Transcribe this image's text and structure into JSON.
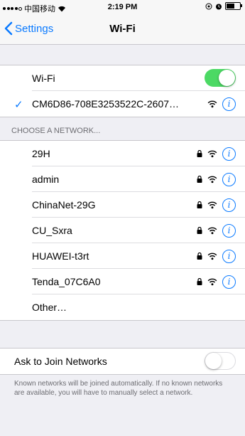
{
  "status_bar": {
    "carrier": "中国移动",
    "time": "2:19 PM"
  },
  "nav": {
    "back_label": "Settings",
    "title": "Wi-Fi"
  },
  "wifi_toggle": {
    "label": "Wi-Fi",
    "state": "on"
  },
  "connected_network": {
    "name": "CM6D86-708E3253522C-2607…"
  },
  "choose_header": "CHOOSE A NETWORK...",
  "networks": [
    {
      "name": "29H"
    },
    {
      "name": "admin"
    },
    {
      "name": "ChinaNet-29G"
    },
    {
      "name": "CU_Sxra"
    },
    {
      "name": "HUAWEI-t3rt"
    },
    {
      "name": "Tenda_07C6A0"
    }
  ],
  "other_label": "Other…",
  "ask_join": {
    "label": "Ask to Join Networks",
    "state": "off",
    "footer": "Known networks will be joined automatically. If no known networks are available, you will have to manually select a network."
  },
  "colors": {
    "accent": "#0a7aff",
    "toggle_on": "#4cd964"
  }
}
